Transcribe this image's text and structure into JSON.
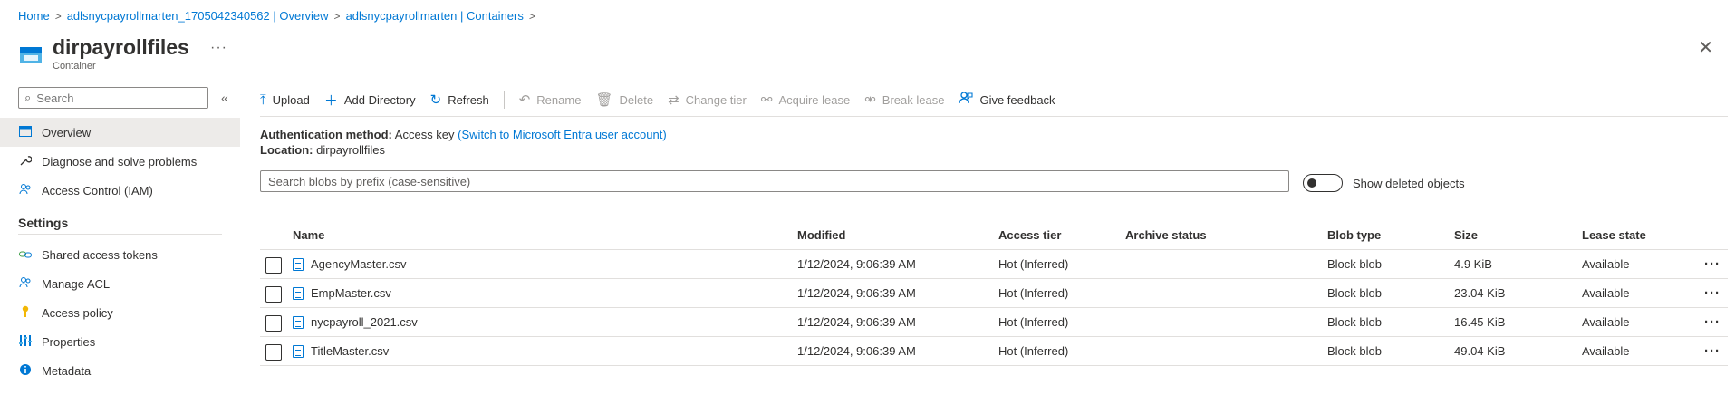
{
  "breadcrumb": {
    "items": [
      "Home",
      "adlsnycpayrollmarten_1705042340562 | Overview",
      "adlsnycpayrollmarten | Containers"
    ],
    "separator": ">"
  },
  "header": {
    "title": "dirpayrollfiles",
    "subtitle": "Container",
    "more": "···",
    "close": "✕"
  },
  "sidebar": {
    "search_placeholder": "Search",
    "collapse": "«",
    "items": [
      {
        "label": "Overview",
        "icon": "overview-icon"
      },
      {
        "label": "Diagnose and solve problems",
        "icon": "wrench-icon"
      },
      {
        "label": "Access Control (IAM)",
        "icon": "people-icon"
      }
    ],
    "section_title": "Settings",
    "settings_items": [
      {
        "label": "Shared access tokens",
        "icon": "link-icon"
      },
      {
        "label": "Manage ACL",
        "icon": "people-icon"
      },
      {
        "label": "Access policy",
        "icon": "key-icon"
      },
      {
        "label": "Properties",
        "icon": "properties-icon"
      },
      {
        "label": "Metadata",
        "icon": "info-icon"
      }
    ]
  },
  "toolbar": {
    "upload": "Upload",
    "add_directory": "Add Directory",
    "refresh": "Refresh",
    "rename": "Rename",
    "delete": "Delete",
    "change_tier": "Change tier",
    "acquire_lease": "Acquire lease",
    "break_lease": "Break lease",
    "give_feedback": "Give feedback"
  },
  "auth": {
    "method_label": "Authentication method:",
    "method_value": "Access key",
    "switch_link": "(Switch to Microsoft Entra user account)",
    "location_label": "Location:",
    "location_value": "dirpayrollfiles"
  },
  "blob_search_placeholder": "Search blobs by prefix (case-sensitive)",
  "toggle_label": "Show deleted objects",
  "table": {
    "columns": [
      "Name",
      "Modified",
      "Access tier",
      "Archive status",
      "Blob type",
      "Size",
      "Lease state"
    ],
    "rows": [
      {
        "name": "AgencyMaster.csv",
        "modified": "1/12/2024, 9:06:39 AM",
        "tier": "Hot (Inferred)",
        "archive": "",
        "type": "Block blob",
        "size": "4.9 KiB",
        "lease": "Available"
      },
      {
        "name": "EmpMaster.csv",
        "modified": "1/12/2024, 9:06:39 AM",
        "tier": "Hot (Inferred)",
        "archive": "",
        "type": "Block blob",
        "size": "23.04 KiB",
        "lease": "Available"
      },
      {
        "name": "nycpayroll_2021.csv",
        "modified": "1/12/2024, 9:06:39 AM",
        "tier": "Hot (Inferred)",
        "archive": "",
        "type": "Block blob",
        "size": "16.45 KiB",
        "lease": "Available"
      },
      {
        "name": "TitleMaster.csv",
        "modified": "1/12/2024, 9:06:39 AM",
        "tier": "Hot (Inferred)",
        "archive": "",
        "type": "Block blob",
        "size": "49.04 KiB",
        "lease": "Available"
      }
    ],
    "row_more": "···"
  },
  "colors": {
    "accent": "#0078d4",
    "text": "#323130",
    "muted": "#605e5c",
    "disabled": "#a19f9d",
    "selected_bg": "#edebe9"
  }
}
